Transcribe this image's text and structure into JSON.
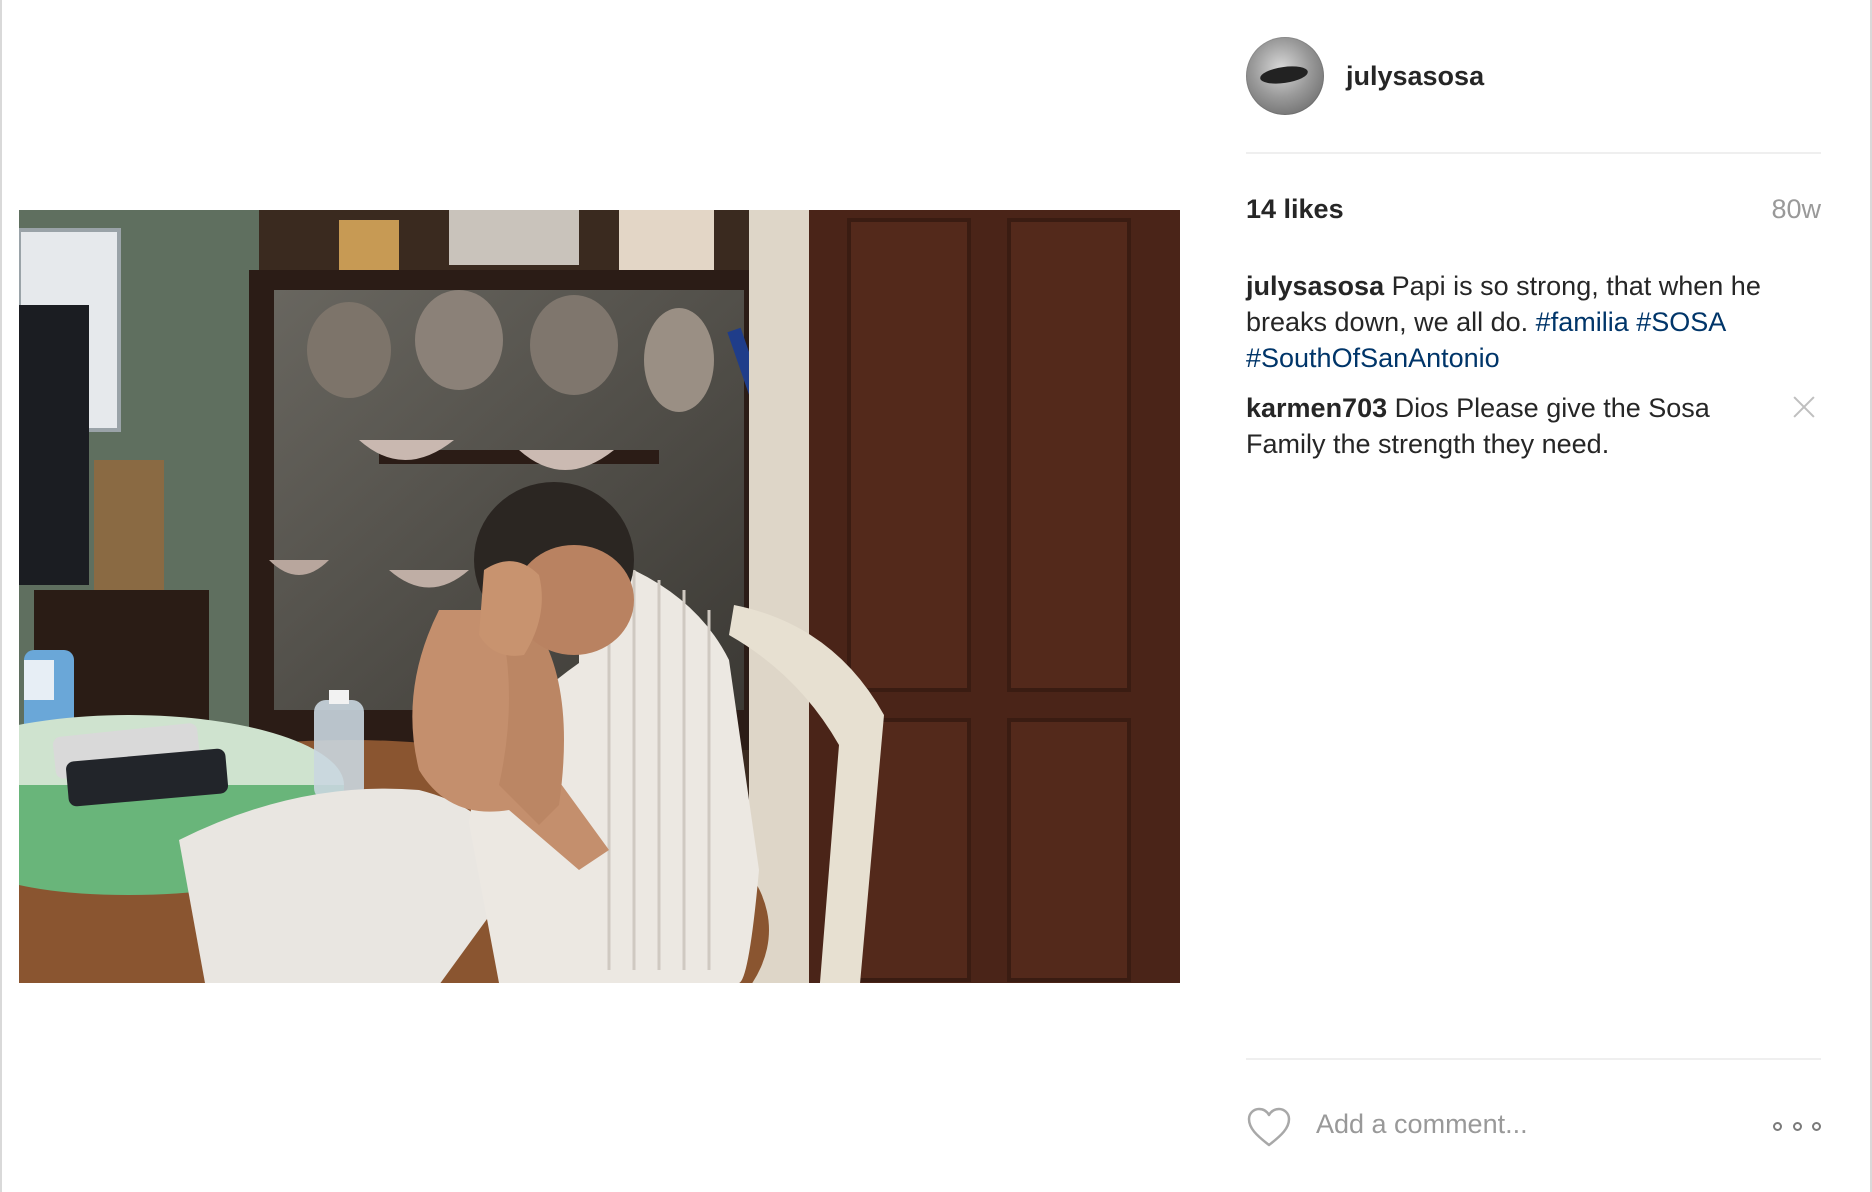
{
  "post": {
    "username": "julysasosa",
    "likes": "14 likes",
    "age": "80w"
  },
  "comments": [
    {
      "author": "julysasosa",
      "text": "Papi is so strong, that when he breaks down, we all do.",
      "hashtags": [
        "#familia",
        "#SOSA",
        "#SouthOfSanAntonio"
      ]
    },
    {
      "author": "karmen703",
      "text": "Dios Please give the Sosa Family the strength they need."
    }
  ],
  "footer": {
    "comment_placeholder": "Add a comment..."
  }
}
